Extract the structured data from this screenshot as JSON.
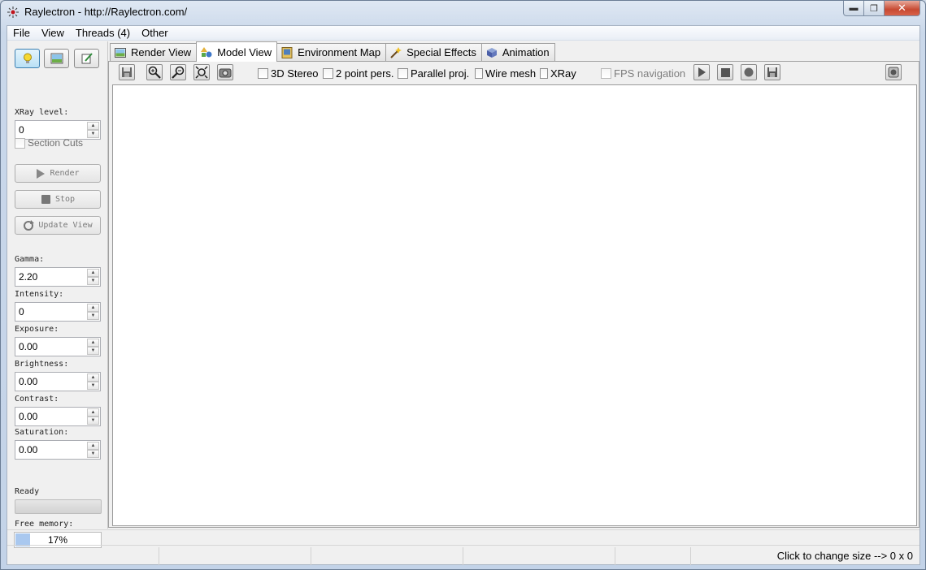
{
  "window": {
    "title": "Raylectron - http://Raylectron.com/"
  },
  "menu": {
    "items": [
      "File",
      "View",
      "Threads (4)",
      "Other"
    ]
  },
  "left_panel": {
    "xray_label": "XRay level:",
    "xray_value": "0",
    "section_cuts_label": "Section Cuts",
    "render_label": "Render",
    "stop_label": "Stop",
    "update_view_label": "Update View",
    "gamma_label": "Gamma:",
    "gamma_value": "2.20",
    "intensity_label": "Intensity:",
    "intensity_value": "0",
    "exposure_label": "Exposure:",
    "exposure_value": "0.00",
    "brightness_label": "Brightness:",
    "brightness_value": "0.00",
    "contrast_label": "Contrast:",
    "contrast_value": "0.00",
    "saturation_label": "Saturation:",
    "saturation_value": "0.00",
    "status_label": "Ready",
    "free_memory_label": "Free memory:",
    "free_memory_value": "17%",
    "free_memory_fraction": 0.17
  },
  "tabs": [
    {
      "label": "Render View",
      "icon": "image-icon"
    },
    {
      "label": "Model View",
      "icon": "shapes-icon",
      "active": true
    },
    {
      "label": "Environment Map",
      "icon": "env-map-icon"
    },
    {
      "label": "Special Effects",
      "icon": "magic-wand-icon"
    },
    {
      "label": "Animation",
      "icon": "cube-icon"
    }
  ],
  "toolbar": {
    "stereo_label": "3D Stereo",
    "two_point_label": "2 point pers.",
    "parallel_label": "Parallel proj.",
    "wire_mesh_label": "Wire mesh",
    "xray_label": "XRay",
    "fps_label": "FPS navigation"
  },
  "status": {
    "size_text": "Click to change size --> 0 x 0"
  },
  "colors": {
    "accent": "#3c7fb1",
    "memory_fill": "#a9c8ef",
    "close_button": "#c74a32"
  }
}
